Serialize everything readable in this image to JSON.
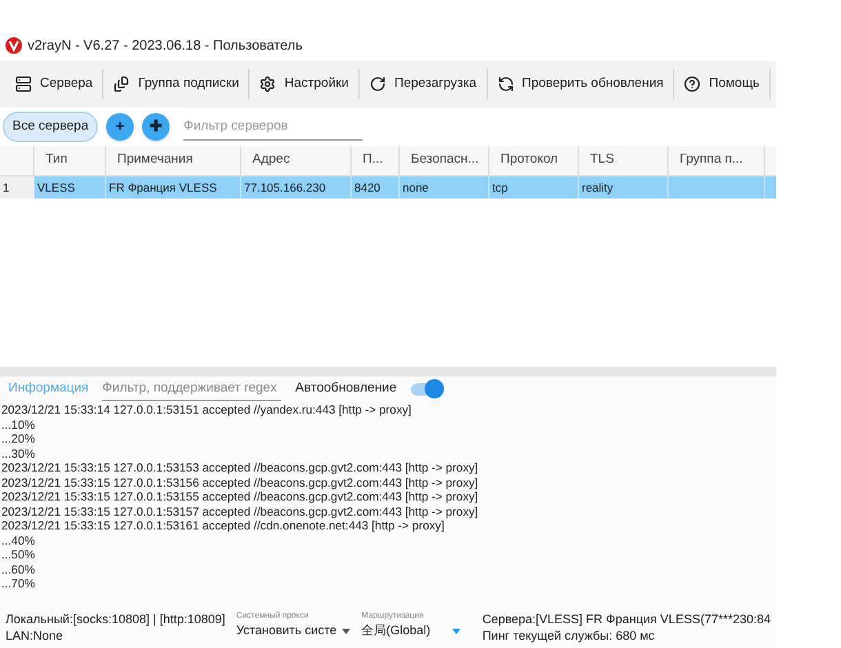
{
  "window": {
    "title": "v2rayN - V6.27 - 2023.06.18 - Пользователь"
  },
  "toolbar": [
    {
      "kind": "servers",
      "label": "Сервера"
    },
    {
      "kind": "subscription",
      "label": "Группа подписки"
    },
    {
      "kind": "settings",
      "label": "Настройки"
    },
    {
      "kind": "reload",
      "label": "Перезагрузка"
    },
    {
      "kind": "update",
      "label": "Проверить обновления"
    },
    {
      "kind": "help",
      "label": "Помощь"
    }
  ],
  "filter_bar": {
    "group_tab": {
      "label": "Все сервера",
      "selected": true
    },
    "add_buttons": [
      "+",
      "✚"
    ],
    "search": {
      "placeholder": "Фильтр серверов"
    }
  },
  "table": {
    "columns": [
      "Тип",
      "Примечания",
      "Адрес",
      "П...",
      "Безопасн...",
      "Протокол",
      "TLS",
      "Группа п..."
    ],
    "rows": [
      {
        "index": "1",
        "selected": true,
        "cells": [
          "VLESS",
          "FR Франция VLESS",
          "77.105.166.230",
          "8420",
          "none",
          "tcp",
          "reality",
          ""
        ]
      }
    ]
  },
  "log": {
    "tab": "Информация",
    "filter": {
      "placeholder": "Фильтр, поддерживает regex"
    },
    "auto_update": {
      "label": "Автообновление",
      "on": true
    },
    "lines": [
      "2023/12/21 15:33:14 127.0.0.1:53151 accepted //yandex.ru:443 [http -> proxy]",
      "...10%",
      "...20%",
      "...30%",
      "2023/12/21 15:33:15 127.0.0.1:53153 accepted //beacons.gcp.gvt2.com:443 [http -> proxy]",
      "2023/12/21 15:33:15 127.0.0.1:53156 accepted //beacons.gcp.gvt2.com:443 [http -> proxy]",
      "2023/12/21 15:33:15 127.0.0.1:53155 accepted //beacons.gcp.gvt2.com:443 [http -> proxy]",
      "2023/12/21 15:33:15 127.0.0.1:53157 accepted //beacons.gcp.gvt2.com:443 [http -> proxy]",
      "2023/12/21 15:33:15 127.0.0.1:53161 accepted //cdn.onenote.net:443 [http -> proxy]",
      "...40%",
      "...50%",
      "...60%",
      "...70%"
    ]
  },
  "status_bar": {
    "local": "Локальный:[socks:10808] | [http:10809]",
    "lan": "LAN:None",
    "system_proxy": {
      "caption": "Системный прокси",
      "value": "Установить систе"
    },
    "routing": {
      "caption": "Маршрутизация",
      "value": "全局(Global)"
    },
    "server": "Сервера:[VLESS] FR Франция VLESS(77***230:84",
    "ping": "Пинг текущей службы: 680 мс"
  }
}
